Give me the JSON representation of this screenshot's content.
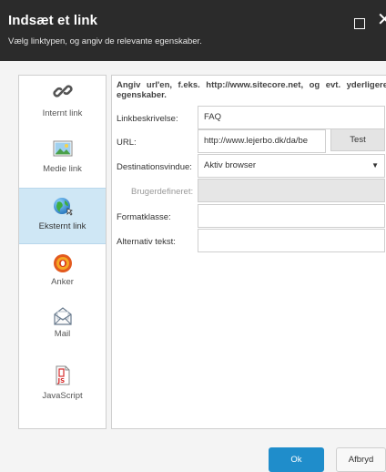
{
  "dialog": {
    "title": "Indsæt et link",
    "subtitle": "Vælg linktypen, og angiv de relevante egenskaber.",
    "maximize_icon": "maximize-icon",
    "close_icon": "close-icon",
    "close_glyph": "✕"
  },
  "sidebar": {
    "items": [
      {
        "label": "Internt link",
        "icon": "chain-link-icon",
        "selected": false
      },
      {
        "label": "Medie link",
        "icon": "image-icon",
        "selected": false
      },
      {
        "label": "Eksternt link",
        "icon": "globe-icon",
        "selected": true
      },
      {
        "label": "Anker",
        "icon": "anchor-target-icon",
        "selected": false
      },
      {
        "label": "Mail",
        "icon": "envelope-icon",
        "selected": false
      },
      {
        "label": "JavaScript",
        "icon": "javascript-file-icon",
        "selected": false
      }
    ],
    "selected_color": "#cfe7f5"
  },
  "main": {
    "instructions": "Angiv url'en, f.eks. http://www.sitecore.net, og evt. yderligere egenskaber.",
    "fields": {
      "link_description": {
        "label": "Linkbeskrivelse:",
        "value": "FAQ"
      },
      "url": {
        "label": "URL:",
        "value": "http://www.lejerbo.dk/da/be"
      },
      "target_window": {
        "label": "Destinationsvindue:",
        "value": "Aktiv browser"
      },
      "custom": {
        "label": "Brugerdefineret:",
        "value": ""
      },
      "style_class": {
        "label": "Formatklasse:",
        "value": ""
      },
      "alt_text": {
        "label": "Alternativ tekst:",
        "value": ""
      }
    },
    "test_label": "Test"
  },
  "footer": {
    "ok_label": "Ok",
    "cancel_label": "Afbryd",
    "accent_color": "#1f8dcb"
  }
}
